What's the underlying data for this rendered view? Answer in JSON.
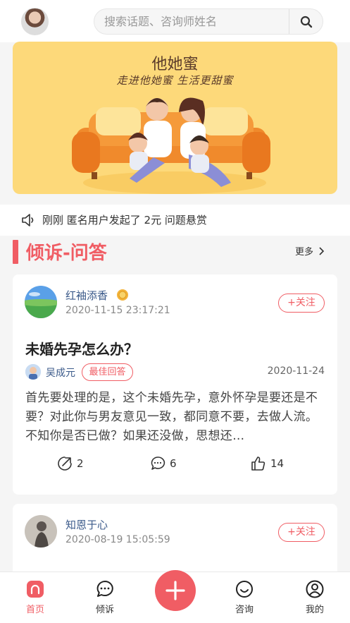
{
  "search": {
    "placeholder": "搜索话题、咨询师姓名"
  },
  "banner": {
    "logo": "他她蜜",
    "slogan": "走进他她蜜 生活更甜蜜"
  },
  "notice": {
    "text": "刚刚 匿名用户发起了 2元 问题悬赏"
  },
  "section": {
    "title": "倾诉-问答",
    "more": "更多"
  },
  "posts": [
    {
      "author": "红袖添香",
      "time": "2020-11-15 23:17:21",
      "follow": "+关注",
      "title": "未婚先孕怎么办？",
      "answer": {
        "author": "吴成元",
        "badge": "最佳回答",
        "date": "2020-11-24",
        "text": "首先要处理的是，这个未婚先孕，意外怀孕是要还是不要？对此你与男友意见一致，都同意不要，去做人流。不知你是否已做？如果还没做，思想还…"
      },
      "stats": {
        "shares": "2",
        "comments": "6",
        "likes": "14"
      }
    },
    {
      "author": "知恩于心",
      "time": "2020-08-19 15:05:59",
      "follow": "+关注"
    }
  ],
  "tabbar": {
    "items": [
      {
        "label": "首页",
        "icon": "home-icon",
        "active": true
      },
      {
        "label": "倾诉",
        "icon": "chat-icon"
      },
      {
        "label": "",
        "icon": "plus-icon"
      },
      {
        "label": "咨询",
        "icon": "smile-icon"
      },
      {
        "label": "我的",
        "icon": "user-icon"
      }
    ]
  },
  "colors": {
    "accent": "#f05d64",
    "banner": "#fdd97a",
    "link": "#3b5a8a"
  }
}
